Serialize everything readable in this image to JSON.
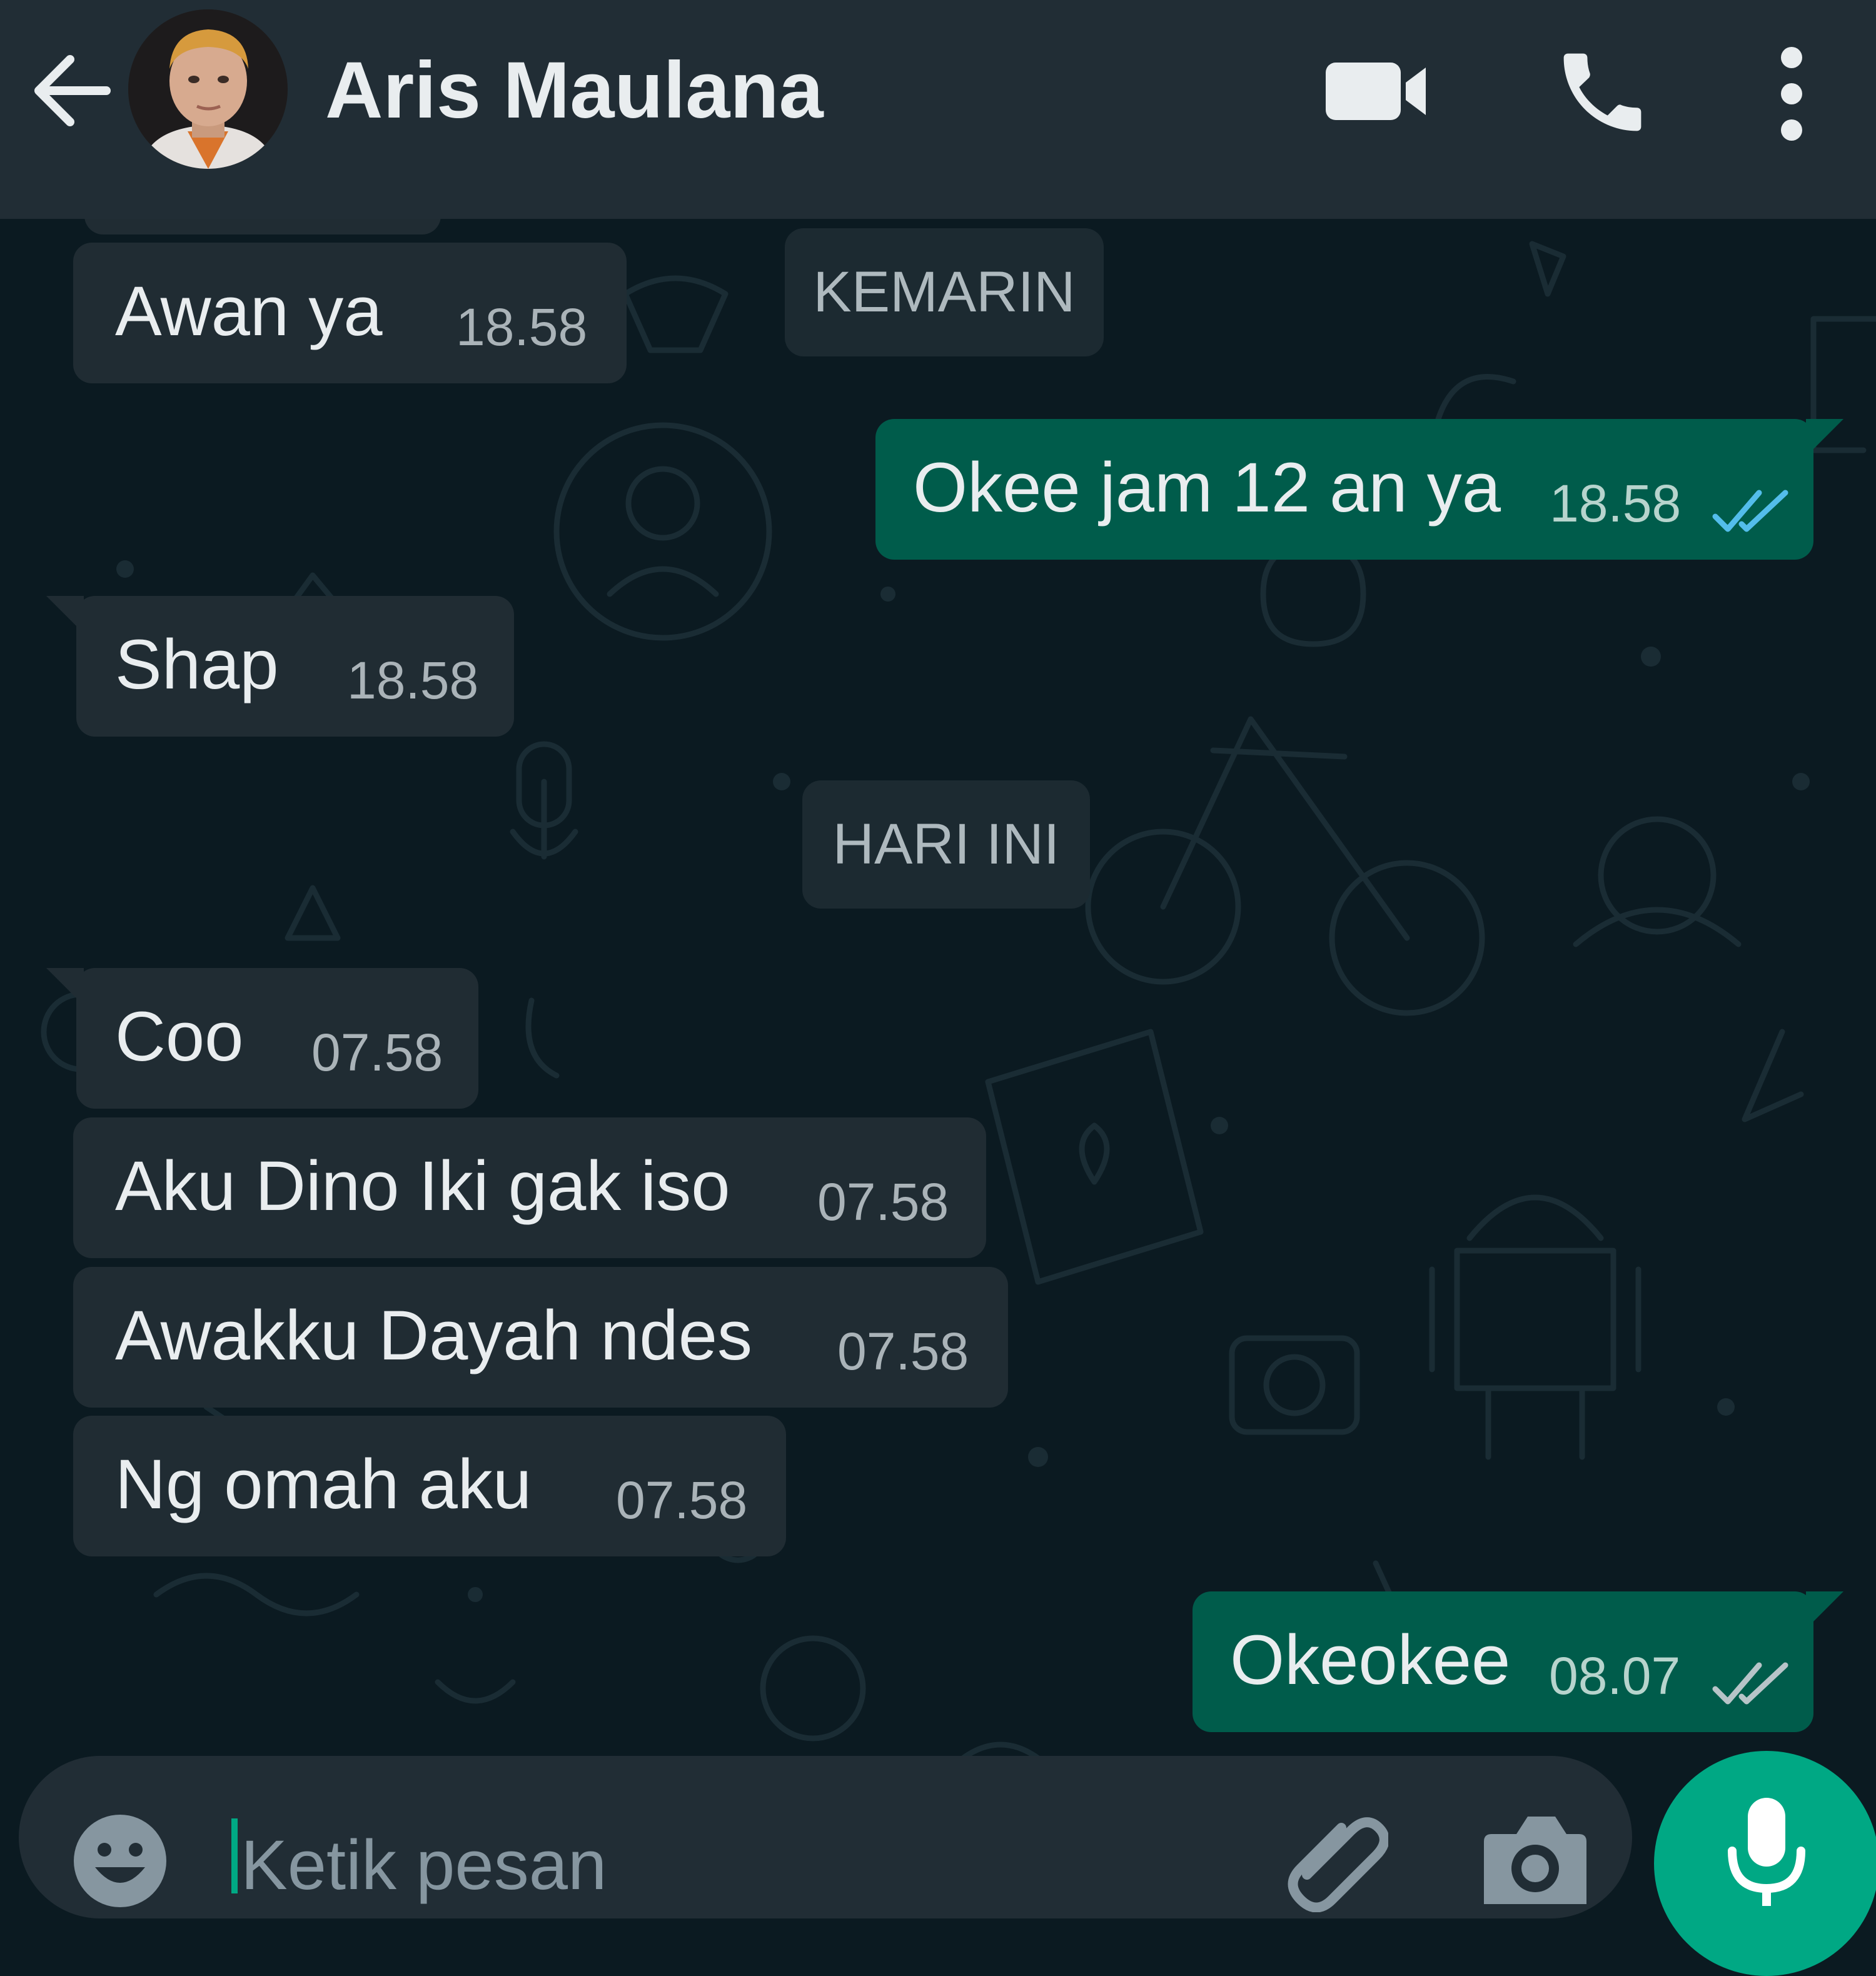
{
  "header": {
    "back_icon": "arrow-left-icon",
    "contact_name": "Aris Maulana",
    "actions": [
      "video-call-icon",
      "voice-call-icon",
      "more-vertical-icon"
    ]
  },
  "date_chips": [
    "KEMARIN",
    "HARI INI"
  ],
  "messages": [
    {
      "direction": "in",
      "text": "Awan ya",
      "time": "18.58"
    },
    {
      "direction": "out",
      "text": "Okee jam 12 an ya",
      "time": "18.58",
      "status": "read"
    },
    {
      "direction": "in",
      "text": "Shap",
      "time": "18.58"
    },
    {
      "direction": "in",
      "text": "Coo",
      "time": "07.58"
    },
    {
      "direction": "in",
      "text": "Aku Dino Iki gak iso",
      "time": "07.58"
    },
    {
      "direction": "in",
      "text": "Awakku Dayah ndes",
      "time": "07.58"
    },
    {
      "direction": "in",
      "text": "Ng omah aku",
      "time": "07.58"
    },
    {
      "direction": "out",
      "text": "Okeokee",
      "time": "08.07",
      "status": "delivered"
    }
  ],
  "composer": {
    "placeholder": "Ketik pesan",
    "icons": [
      "emoji-icon",
      "attachment-icon",
      "camera-icon",
      "microphone-icon"
    ]
  },
  "colors": {
    "header_bg": "#212d35",
    "chat_bg": "#0b1a21",
    "incoming_bubble": "#202c33",
    "outgoing_bubble": "#005c4b",
    "read_tick": "#53bdeb",
    "accent": "#00a884"
  }
}
